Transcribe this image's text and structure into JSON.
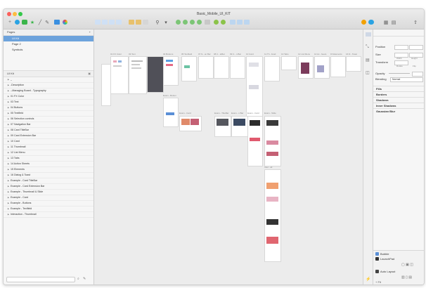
{
  "window": {
    "title": "Basic_Mobile_UI_KIT"
  },
  "toolbar": {
    "colors": {
      "insert": "#2aa3e3",
      "shape": "#3bb54a",
      "symbol": "#f2a100",
      "style": "#9b59b6",
      "pink": "#e0527a",
      "teal": "#27ae96"
    }
  },
  "pages": {
    "header": "Pages",
    "add": "+",
    "items": [
      {
        "label": "UI Kit",
        "selected": true
      },
      {
        "label": "Page 2",
        "selected": false
      },
      {
        "label": "Symbols",
        "selected": false
      }
    ]
  },
  "layers": {
    "header": "UI Kit",
    "items": [
      "_",
      "-Description",
      "--Managing Board - Typography",
      "01 FX Color",
      "03 Text",
      "04 Buttons",
      "05 Textfield",
      "06 Selection controls",
      "07 Navigation Bar",
      "08 Card TitleBar",
      "09 Card Extension Bar",
      "10 Card",
      "11 Thumbnail",
      "12 List Menu",
      "13 Tabs",
      "14 Action Sheets",
      "15 Elements",
      "16 Dialog & Toast",
      "Example - Card TitleBar",
      "Example - Card Extension Bar",
      "Example - Thumbnail & Slide",
      "Example - Card",
      "Example - Buttons",
      "Example - Textfield",
      "Interaction - Thumbnail"
    ]
  },
  "artboards": [
    {
      "label": "01 FX Color"
    },
    {
      "label": "03 Text"
    },
    {
      "label": "04 Buttons"
    },
    {
      "label": "05 Textfield"
    },
    {
      "label": "07 N...on Bar"
    },
    {
      "label": "08 C...leBar"
    },
    {
      "label": "09 C...n Bar"
    },
    {
      "label": "10 Card"
    },
    {
      "label": "11 Th...bnail"
    },
    {
      "label": "13 Tabs"
    },
    {
      "label": "12 List Menu"
    },
    {
      "label": "14 Ac...heets"
    },
    {
      "label": "15 Elements"
    },
    {
      "label": "16 D...Toast"
    },
    {
      "label": "Exam...Button"
    },
    {
      "label": "Exam...Card"
    },
    {
      "label": "Exam...TitleBar"
    },
    {
      "label": "Exam...n Bar"
    },
    {
      "label": "Exam...Card"
    },
    {
      "label": "Exam...Slide"
    },
    {
      "label": "Inter...ail"
    }
  ],
  "inspector": {
    "position": "Position",
    "size": "Size",
    "width": "Width",
    "height": "Height",
    "transform": "Transform",
    "rotate": "Rotate",
    "flip": "Flip",
    "opacity": "Opacity",
    "blending": "Blending",
    "blending_value": "Normal",
    "sections": [
      "Fills",
      "Borders",
      "Shadows",
      "Inner Shadows",
      "Gaussian Blur"
    ],
    "libs": {
      "title": "Bubble",
      "item": "LaunchPad",
      "item2": "Auto Layout"
    }
  },
  "footer": {
    "zoom": "Fit"
  }
}
